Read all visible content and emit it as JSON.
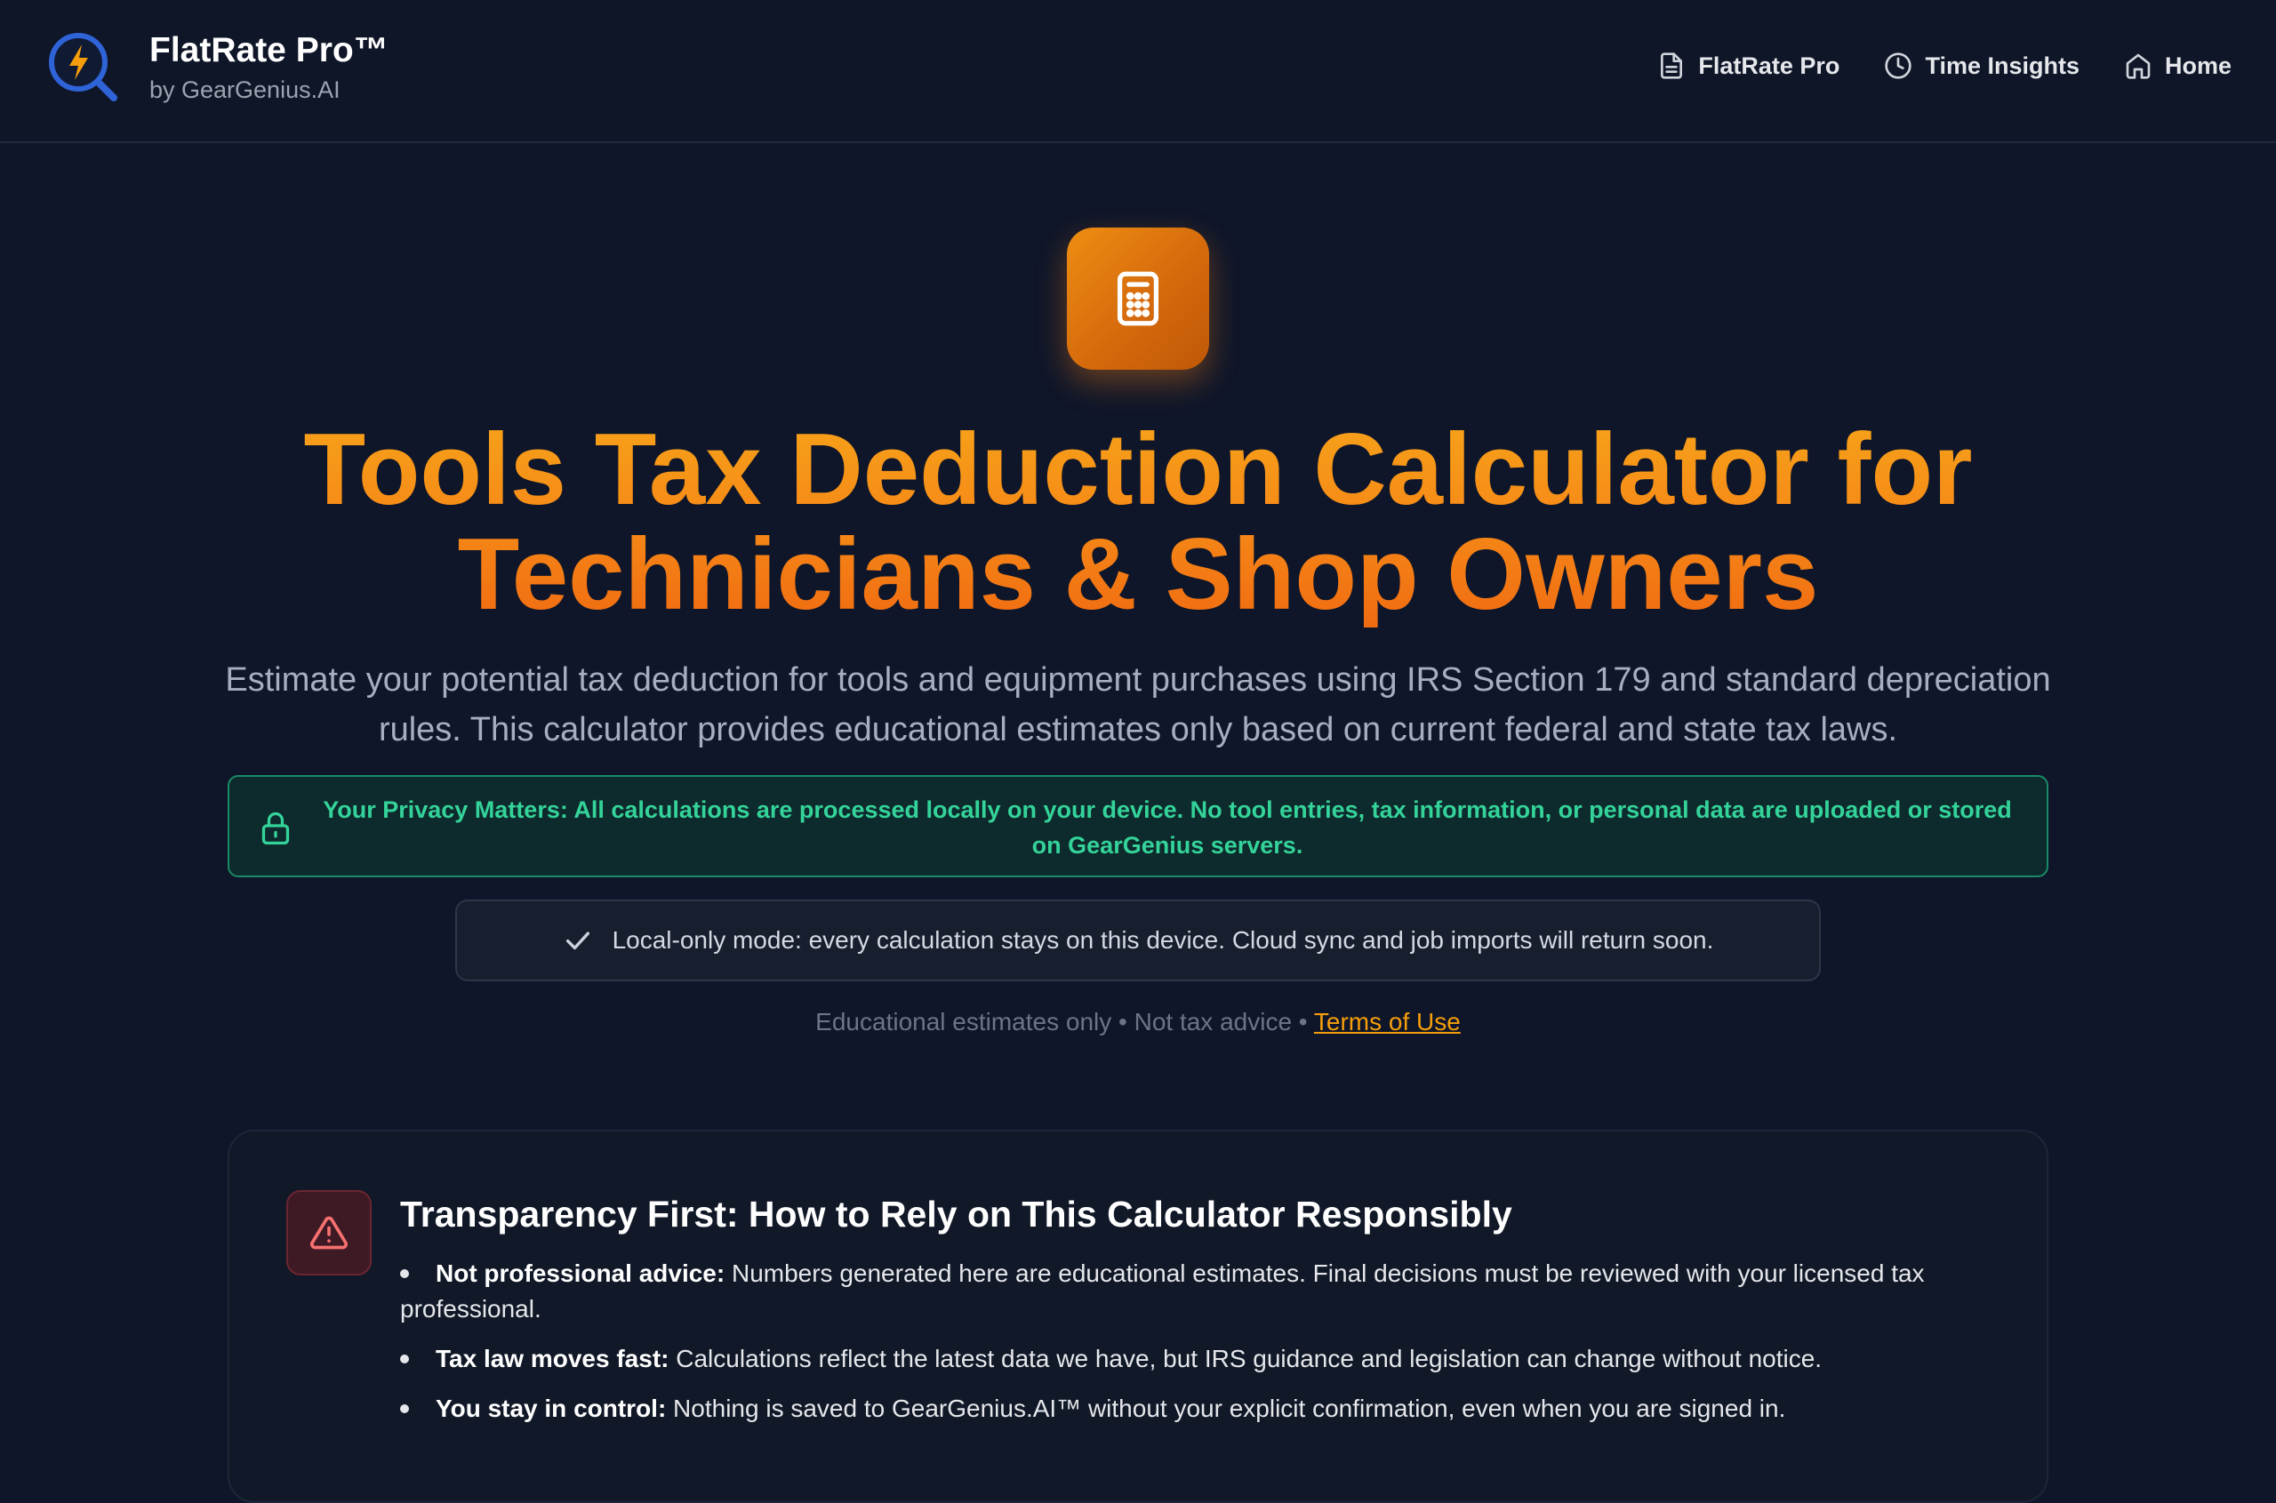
{
  "header": {
    "brand_name": "FlatRate Pro™",
    "brand_sub": "by GearGenius.AI",
    "logo_icon": "bolt-magnifier-icon",
    "nav": [
      {
        "label": "FlatRate Pro",
        "icon": "document-icon"
      },
      {
        "label": "Time Insights",
        "icon": "clock-icon"
      },
      {
        "label": "Home",
        "icon": "home-icon"
      }
    ]
  },
  "hero": {
    "icon": "calculator-icon",
    "title_line1": "Tools Tax Deduction Calculator for",
    "title_line2": "Technicians & Shop Owners",
    "description": "Estimate your potential tax deduction for tools and equipment purchases using IRS Section 179 and standard depreciation rules. This calculator provides educational estimates only based on current federal and state tax laws."
  },
  "privacy": {
    "icon": "lock-icon",
    "text": "Your Privacy Matters: All calculations are processed locally on your device. No tool entries, tax information, or personal data are uploaded or stored on GearGenius servers."
  },
  "local_mode": {
    "icon": "check-icon",
    "text": "Local-only mode: every calculation stays on this device. Cloud sync and job imports will return soon."
  },
  "disclaimer": {
    "text": "Educational estimates only • Not tax advice • ",
    "link": "Terms of Use"
  },
  "transparency": {
    "icon": "warning-triangle-icon",
    "title": "Transparency First: How to Rely on This Calculator Responsibly",
    "items": [
      {
        "label": "Not professional advice:",
        "text": " Numbers generated here are educational estimates. Final decisions must be reviewed with your licensed tax professional."
      },
      {
        "label": "Tax law moves fast:",
        "text": " Calculations reflect the latest data we have, but IRS guidance and legislation can change without notice."
      },
      {
        "label": "You stay in control:",
        "text": " Nothing is saved to GearGenius.AI™ without your explicit confirmation, even when you are signed in."
      }
    ]
  },
  "colors": {
    "background": "#0f1629",
    "accent_orange": "#f58616",
    "privacy_green": "#34d399",
    "link_amber": "#f59e0b",
    "warning_red": "#f87171"
  }
}
